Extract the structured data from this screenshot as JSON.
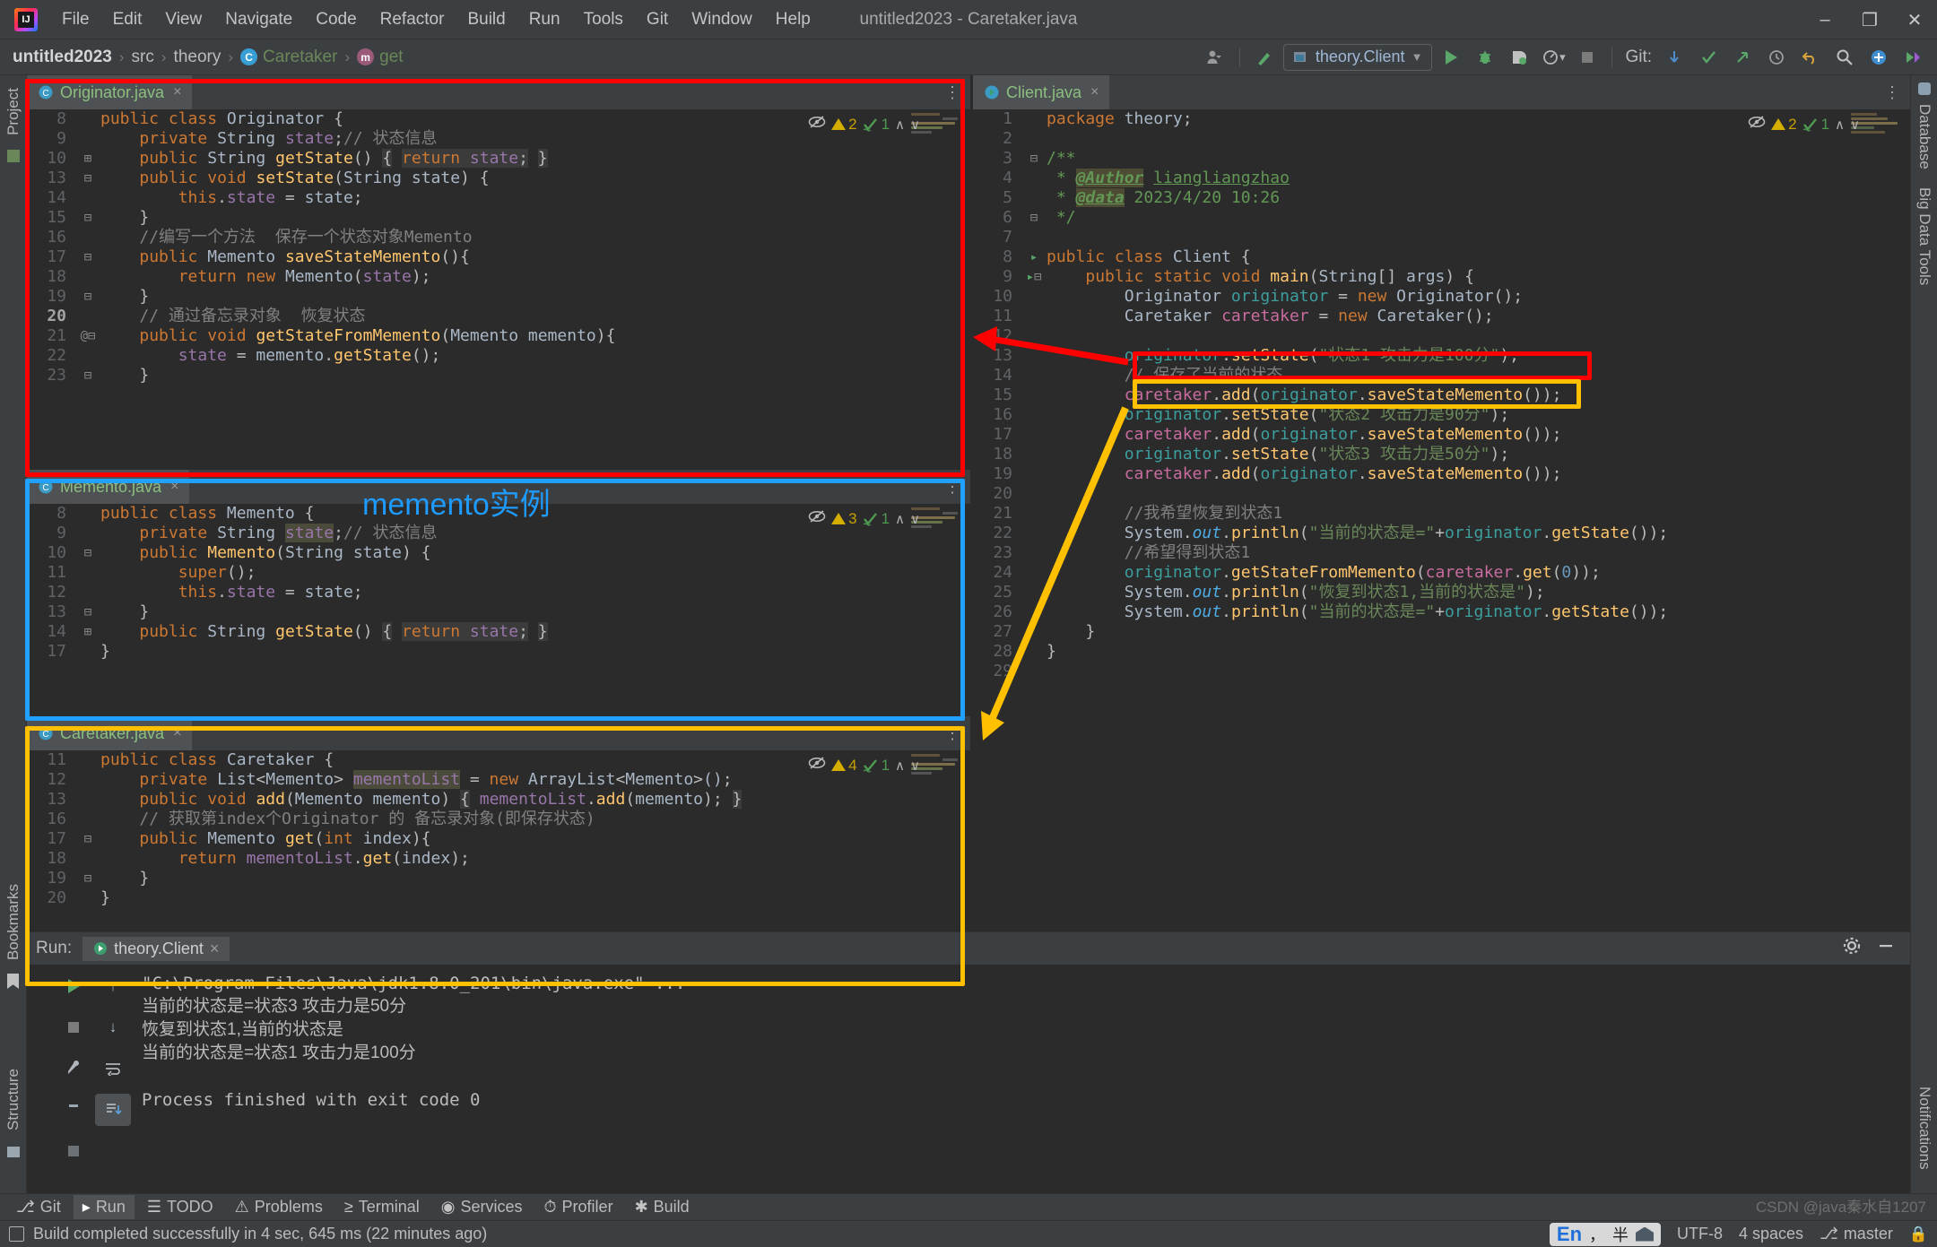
{
  "window": {
    "title": "untitled2023 - Caretaker.java",
    "minimize": "–",
    "maximize": "❐",
    "close": "✕"
  },
  "menu": [
    "File",
    "Edit",
    "View",
    "Navigate",
    "Code",
    "Refactor",
    "Build",
    "Run",
    "Tools",
    "Git",
    "Window",
    "Help"
  ],
  "breadcrumb": {
    "project": "untitled2023",
    "src": "src",
    "package": "theory",
    "class": "Caretaker",
    "class_icon": "C",
    "method": "get",
    "method_icon": "m",
    "sep": "›"
  },
  "toolbar": {
    "run_config": "theory.Client",
    "run_config_caret": "▼",
    "git_label": "Git:",
    "avatar_icon": "user-icon",
    "build_icon": "hammer-icon",
    "run_icon": "run-icon",
    "debug_icon": "debug-icon",
    "coverage_icon": "coverage-icon",
    "profile_icon": "profile-icon",
    "stop_icon": "stop-icon",
    "update_icon": "update-project-icon",
    "commit_icon": "commit-icon",
    "push_icon": "push-icon",
    "history_icon": "history-icon",
    "rollback_icon": "rollback-icon",
    "search_icon": "search-icon",
    "settings_icon": "settings-icon",
    "plugins_icon": "plugins-icon"
  },
  "rails": {
    "left": [
      "Project",
      "Bookmarks",
      "Structure"
    ],
    "right": [
      "Database",
      "Big Data Tools",
      "Notifications"
    ]
  },
  "editors": [
    {
      "tab": "Originator.java",
      "tab_icon": "java-class-icon",
      "close": "×",
      "inspection": {
        "warnings": "2",
        "checks": "1",
        "eye": "inspection-off-icon",
        "up": "∧",
        "down": "∨"
      },
      "lines": [
        {
          "n": "8",
          "fold": "",
          "html": "<span class='kw'>public class</span> <span class='cls'>Originator</span> {"
        },
        {
          "n": "9",
          "fold": "",
          "html": "    <span class='kw'>private</span> <span class='cls'>String</span> <span class='fld'>state</span>;<span class='cmt'>// 状态信息</span>"
        },
        {
          "n": "10",
          "fold": "+",
          "html": "    <span class='kw'>public</span> <span class='cls'>String</span> <span class='fn'>getState</span>() <span class='hl-soft'>{</span> <span class='hl-soft'><span class='kw'>return</span> <span class='fld'>state</span>;</span> <span class='hl-soft'>}</span>"
        },
        {
          "n": "13",
          "fold": "-",
          "html": "    <span class='kw'>public</span> <span class='kw'>void</span> <span class='fn'>setState</span>(<span class='cls'>String</span> <span class='par'>state</span>) {"
        },
        {
          "n": "14",
          "fold": "",
          "html": "        <span class='kw'>this</span>.<span class='fld'>state</span> = <span class='par'>state</span>;"
        },
        {
          "n": "15",
          "fold": "-",
          "html": "    }"
        },
        {
          "n": "16",
          "fold": "",
          "html": "    <span class='cmt'>//编写一个方法  保存一个状态对象Memento</span>"
        },
        {
          "n": "17",
          "fold": "-",
          "html": "    <span class='kw'>public</span> <span class='cls'>Memento</span> <span class='fn'>saveStateMemento</span>(){"
        },
        {
          "n": "18",
          "fold": "",
          "html": "        <span class='kw'>return</span> <span class='kw'>new</span> <span class='cls'>Memento</span>(<span class='fld'>state</span>);"
        },
        {
          "n": "19",
          "fold": "-",
          "html": "    }"
        },
        {
          "n": "20",
          "fold": "",
          "html": "    <span class='cmt'>// 通过备忘录对象  恢复状态</span>",
          "current": true
        },
        {
          "n": "21",
          "fold": "-",
          "html": "    <span class='kw'>public</span> <span class='kw'>void</span> <span class='fn'>getStateFromMemento</span>(<span class='cls'>Memento</span> <span class='par'>memento</span>){",
          "at": "@"
        },
        {
          "n": "22",
          "fold": "",
          "html": "        <span class='fld'>state</span> = <span class='par'>memento</span>.<span class='meth'>getState</span>();"
        },
        {
          "n": "23",
          "fold": "-",
          "html": "    }"
        }
      ]
    },
    {
      "tab": "Memento.java",
      "tab_icon": "java-class-icon",
      "close": "×",
      "inspection": {
        "warnings": "3",
        "checks": "1",
        "eye": "inspection-off-icon",
        "up": "∧",
        "down": "∨"
      },
      "lines": [
        {
          "n": "8",
          "fold": "",
          "html": "<span class='kw'>public class</span> <span class='cls'>Memento</span> {"
        },
        {
          "n": "9",
          "fold": "",
          "html": "    <span class='kw'>private</span> <span class='cls'>String</span> <span class='hl-ident'><span class='fld'>state</span></span>;<span class='cmt'>// 状态信息</span>"
        },
        {
          "n": "10",
          "fold": "-",
          "html": "    <span class='kw'>public</span> <span class='fn'>Memento</span>(<span class='cls'>String</span> <span class='par'>state</span>) {"
        },
        {
          "n": "11",
          "fold": "",
          "html": "        <span class='kw'>super</span>();"
        },
        {
          "n": "12",
          "fold": "",
          "html": "        <span class='kw'>this</span>.<span class='fld'>state</span> = <span class='par'>state</span>;"
        },
        {
          "n": "13",
          "fold": "-",
          "html": "    }"
        },
        {
          "n": "14",
          "fold": "+",
          "html": "    <span class='kw'>public</span> <span class='cls'>String</span> <span class='fn'>getState</span>() <span class='hl-soft'>{</span> <span class='hl-soft'><span class='kw'>return</span> <span class='fld'>state</span>;</span> <span class='hl-soft'>}</span>"
        },
        {
          "n": "17",
          "fold": "",
          "html": "}"
        }
      ]
    },
    {
      "tab": "Caretaker.java",
      "tab_icon": "java-class-icon",
      "close": "×",
      "inspection": {
        "warnings": "4",
        "checks": "1",
        "eye": "inspection-off-icon",
        "up": "∧",
        "down": "∨"
      },
      "lines": [
        {
          "n": "11",
          "fold": "",
          "html": "<span class='kw'>public class</span> <span class='cls'>Caretaker</span> {"
        },
        {
          "n": "12",
          "fold": "",
          "html": "    <span class='kw'>private</span> <span class='cls'>List</span>&lt;<span class='cls'>Memento</span>&gt; <span class='hl-ident'><span class='fld'>mementoList</span></span> = <span class='kw'>new</span> <span class='cls'>ArrayList</span>&lt;<span class='cls'>Memento</span>&gt;<span class='par'>()</span>;"
        },
        {
          "n": "13",
          "fold": "",
          "html": "    <span class='kw'>public</span> <span class='kw'>void</span> <span class='fn'>add</span>(<span class='cls'>Memento</span> <span class='par'>memento</span>) <span class='hl-soft'>{</span> <span class='fld'>mementoList</span>.<span class='meth'>add</span>(<span class='par'>memento</span>); <span class='hl-soft'>}</span>"
        },
        {
          "n": "16",
          "fold": "",
          "html": "    <span class='cmt'>// 获取第index个Originator 的 备忘录对象(即保存状态)</span>"
        },
        {
          "n": "17",
          "fold": "-",
          "html": "    <span class='kw'>public</span> <span class='cls'>Memento</span> <span class='fn'>get</span>(<span class='kw'>int</span> <span class='par'>index</span>){"
        },
        {
          "n": "18",
          "fold": "",
          "html": "        <span class='kw'>return</span> <span class='fld'>mementoList</span>.<span class='meth'>get</span>(<span class='par'>index</span>);"
        },
        {
          "n": "19",
          "fold": "-",
          "html": "    }"
        },
        {
          "n": "20",
          "fold": "",
          "html": "}"
        }
      ]
    }
  ],
  "client_editor": {
    "tab": "Client.java",
    "tab_icon": "java-run-class-icon",
    "close": "×",
    "inspection": {
      "warnings": "2",
      "checks": "1",
      "eye": "inspection-off-icon",
      "up": "∧",
      "down": "∨"
    },
    "lines": [
      {
        "n": "1",
        "fold": "",
        "html": "<span class='kw'>package</span> <span class='cls'>theory</span>;"
      },
      {
        "n": "2",
        "fold": "",
        "html": ""
      },
      {
        "n": "3",
        "fold": "-",
        "html": "<span class='doc'>/**</span>"
      },
      {
        "n": "4",
        "fold": "",
        "html": "<span class='doc'> * <span class='doctag'>@Author</span> <u>liangliangzhao</u></span>"
      },
      {
        "n": "5",
        "fold": "",
        "html": "<span class='doc'> * <span class='doctag'>@data</span> 2023/4/20 10:26</span>"
      },
      {
        "n": "6",
        "fold": "-",
        "html": "<span class='doc'> */</span>"
      },
      {
        "n": "7",
        "fold": "",
        "html": ""
      },
      {
        "n": "8",
        "fold": "",
        "html": "<span class='kw'>public class</span> <span class='cls'>Client</span> {",
        "gutter_run": true
      },
      {
        "n": "9",
        "fold": "-",
        "html": "    <span class='kw'>public static</span> <span class='kw'>void</span> <span class='fn'>main</span>(<span class='cls'>String</span>[] <span class='par'>args</span>) {",
        "gutter_run": true
      },
      {
        "n": "10",
        "fold": "",
        "html": "        <span class='cls'>Originator</span> <span class='var-o'>originator</span> = <span class='kw'>new</span> <span class='cls'>Originator</span>();"
      },
      {
        "n": "11",
        "fold": "",
        "html": "        <span class='cls'>Caretaker</span> <span class='var-c'>caretaker</span> = <span class='kw'>new</span> <span class='cls'>Caretaker</span>();"
      },
      {
        "n": "12",
        "fold": "",
        "html": ""
      },
      {
        "n": "13",
        "fold": "",
        "html": "        <span class='var-o'>originator</span>.<span class='meth'>setState</span>(<span class='str'>\"状态1 攻击力是100分\"</span>);"
      },
      {
        "n": "14",
        "fold": "",
        "html": "        <span class='cmt'>// 保存了当前的状态</span>"
      },
      {
        "n": "15",
        "fold": "",
        "html": "        <span class='var-c'>caretaker</span>.<span class='meth'>add</span>(<span class='var-o'>originator</span>.<span class='meth'>saveStateMemento</span>());"
      },
      {
        "n": "16",
        "fold": "",
        "html": "        <span class='var-o'>originator</span>.<span class='meth'>setState</span>(<span class='str'>\"状态2 攻击力是90分\"</span>);"
      },
      {
        "n": "17",
        "fold": "",
        "html": "        <span class='var-c'>caretaker</span>.<span class='meth'>add</span>(<span class='var-o'>originator</span>.<span class='meth'>saveStateMemento</span>());"
      },
      {
        "n": "18",
        "fold": "",
        "html": "        <span class='var-o'>originator</span>.<span class='meth'>setState</span>(<span class='str'>\"状态3 攻击力是50分\"</span>);"
      },
      {
        "n": "19",
        "fold": "",
        "html": "        <span class='var-c'>caretaker</span>.<span class='meth'>add</span>(<span class='var-o'>originator</span>.<span class='meth'>saveStateMemento</span>());"
      },
      {
        "n": "20",
        "fold": "",
        "html": ""
      },
      {
        "n": "21",
        "fold": "",
        "html": "        <span class='cmt'>//我希望恢复到状态1</span>"
      },
      {
        "n": "22",
        "fold": "",
        "html": "        <span class='cls'>System</span>.<span class='stat'><i>out</i></span>.<span class='meth'>println</span>(<span class='str'>\"当前的状态是=\"</span>+<span class='var-o'>originator</span>.<span class='meth'>getState</span>());"
      },
      {
        "n": "23",
        "fold": "",
        "html": "        <span class='cmt'>//希望得到状态1</span>"
      },
      {
        "n": "24",
        "fold": "",
        "html": "        <span class='var-o'>originator</span>.<span class='meth'>getStateFromMemento</span>(<span class='var-c'>caretaker</span>.<span class='meth'>get</span>(<span class='num'>0</span>));"
      },
      {
        "n": "25",
        "fold": "",
        "html": "        <span class='cls'>System</span>.<span class='stat'><i>out</i></span>.<span class='meth'>println</span>(<span class='str'>\"恢复到状态1,当前的状态是\"</span>);"
      },
      {
        "n": "26",
        "fold": "",
        "html": "        <span class='cls'>System</span>.<span class='stat'><i>out</i></span>.<span class='meth'>println</span>(<span class='str'>\"当前的状态是=\"</span>+<span class='var-o'>originator</span>.<span class='meth'>getState</span>());"
      },
      {
        "n": "27",
        "fold": "",
        "html": "    }"
      },
      {
        "n": "28",
        "fold": "",
        "html": "}"
      },
      {
        "n": "29",
        "fold": "",
        "html": ""
      }
    ]
  },
  "annotations": {
    "memento_label": "memento实例"
  },
  "run_panel": {
    "label": "Run:",
    "tab": "theory.Client",
    "tab_close": "×",
    "settings_icon": "gear-icon",
    "minimize_icon": "minimize-icon",
    "console": [
      "\"C:\\Program Files\\Java\\jdk1.8.0_201\\bin\\java.exe\" ...",
      "当前的状态是=状态3 攻击力是50分",
      "恢复到状态1,当前的状态是",
      "当前的状态是=状态1 攻击力是100分",
      "",
      "Process finished with exit code 0"
    ]
  },
  "tool_windows": [
    {
      "icon": "git-icon",
      "label": "Git",
      "active": false
    },
    {
      "icon": "run-icon",
      "label": "Run",
      "active": true
    },
    {
      "icon": "todo-icon",
      "label": "TODO",
      "active": false
    },
    {
      "icon": "problems-icon",
      "label": "Problems",
      "active": false
    },
    {
      "icon": "terminal-icon",
      "label": "Terminal",
      "active": false
    },
    {
      "icon": "services-icon",
      "label": "Services",
      "active": false
    },
    {
      "icon": "profiler-icon",
      "label": "Profiler",
      "active": false
    },
    {
      "icon": "build-icon",
      "label": "Build",
      "active": false
    }
  ],
  "status_bar": {
    "message": "Build completed successfully in 4 sec, 645 ms (22 minutes ago)",
    "message_icon": "build-status-icon",
    "encoding": "UTF-8",
    "indent": "4 spaces",
    "branch": "master",
    "branch_icon": "branch-icon",
    "ime_en": "En",
    "ime_punct": "，",
    "ime_half": "半",
    "lock_icon": "lock-icon",
    "watermark": "CSDN @java秦水自1207"
  },
  "colors": {
    "accent_red": "#ff0000",
    "accent_blue": "#20a0ff",
    "accent_yellow": "#ffc000",
    "editor_bg": "#2b2b2b",
    "chrome_bg": "#3c3f41"
  }
}
